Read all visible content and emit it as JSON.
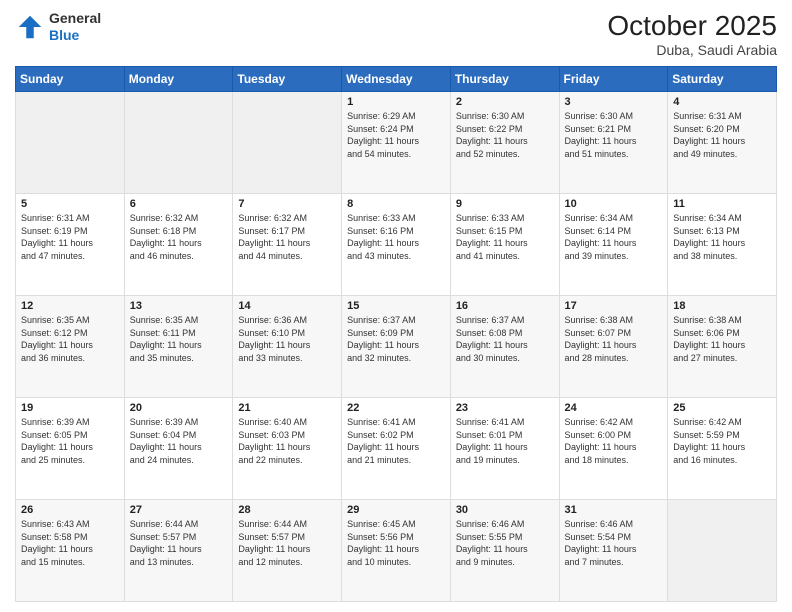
{
  "header": {
    "logo": {
      "general": "General",
      "blue": "Blue"
    },
    "title": "October 2025",
    "subtitle": "Duba, Saudi Arabia"
  },
  "days_of_week": [
    "Sunday",
    "Monday",
    "Tuesday",
    "Wednesday",
    "Thursday",
    "Friday",
    "Saturday"
  ],
  "weeks": [
    [
      {
        "day": "",
        "info": ""
      },
      {
        "day": "",
        "info": ""
      },
      {
        "day": "",
        "info": ""
      },
      {
        "day": "1",
        "info": "Sunrise: 6:29 AM\nSunset: 6:24 PM\nDaylight: 11 hours\nand 54 minutes."
      },
      {
        "day": "2",
        "info": "Sunrise: 6:30 AM\nSunset: 6:22 PM\nDaylight: 11 hours\nand 52 minutes."
      },
      {
        "day": "3",
        "info": "Sunrise: 6:30 AM\nSunset: 6:21 PM\nDaylight: 11 hours\nand 51 minutes."
      },
      {
        "day": "4",
        "info": "Sunrise: 6:31 AM\nSunset: 6:20 PM\nDaylight: 11 hours\nand 49 minutes."
      }
    ],
    [
      {
        "day": "5",
        "info": "Sunrise: 6:31 AM\nSunset: 6:19 PM\nDaylight: 11 hours\nand 47 minutes."
      },
      {
        "day": "6",
        "info": "Sunrise: 6:32 AM\nSunset: 6:18 PM\nDaylight: 11 hours\nand 46 minutes."
      },
      {
        "day": "7",
        "info": "Sunrise: 6:32 AM\nSunset: 6:17 PM\nDaylight: 11 hours\nand 44 minutes."
      },
      {
        "day": "8",
        "info": "Sunrise: 6:33 AM\nSunset: 6:16 PM\nDaylight: 11 hours\nand 43 minutes."
      },
      {
        "day": "9",
        "info": "Sunrise: 6:33 AM\nSunset: 6:15 PM\nDaylight: 11 hours\nand 41 minutes."
      },
      {
        "day": "10",
        "info": "Sunrise: 6:34 AM\nSunset: 6:14 PM\nDaylight: 11 hours\nand 39 minutes."
      },
      {
        "day": "11",
        "info": "Sunrise: 6:34 AM\nSunset: 6:13 PM\nDaylight: 11 hours\nand 38 minutes."
      }
    ],
    [
      {
        "day": "12",
        "info": "Sunrise: 6:35 AM\nSunset: 6:12 PM\nDaylight: 11 hours\nand 36 minutes."
      },
      {
        "day": "13",
        "info": "Sunrise: 6:35 AM\nSunset: 6:11 PM\nDaylight: 11 hours\nand 35 minutes."
      },
      {
        "day": "14",
        "info": "Sunrise: 6:36 AM\nSunset: 6:10 PM\nDaylight: 11 hours\nand 33 minutes."
      },
      {
        "day": "15",
        "info": "Sunrise: 6:37 AM\nSunset: 6:09 PM\nDaylight: 11 hours\nand 32 minutes."
      },
      {
        "day": "16",
        "info": "Sunrise: 6:37 AM\nSunset: 6:08 PM\nDaylight: 11 hours\nand 30 minutes."
      },
      {
        "day": "17",
        "info": "Sunrise: 6:38 AM\nSunset: 6:07 PM\nDaylight: 11 hours\nand 28 minutes."
      },
      {
        "day": "18",
        "info": "Sunrise: 6:38 AM\nSunset: 6:06 PM\nDaylight: 11 hours\nand 27 minutes."
      }
    ],
    [
      {
        "day": "19",
        "info": "Sunrise: 6:39 AM\nSunset: 6:05 PM\nDaylight: 11 hours\nand 25 minutes."
      },
      {
        "day": "20",
        "info": "Sunrise: 6:39 AM\nSunset: 6:04 PM\nDaylight: 11 hours\nand 24 minutes."
      },
      {
        "day": "21",
        "info": "Sunrise: 6:40 AM\nSunset: 6:03 PM\nDaylight: 11 hours\nand 22 minutes."
      },
      {
        "day": "22",
        "info": "Sunrise: 6:41 AM\nSunset: 6:02 PM\nDaylight: 11 hours\nand 21 minutes."
      },
      {
        "day": "23",
        "info": "Sunrise: 6:41 AM\nSunset: 6:01 PM\nDaylight: 11 hours\nand 19 minutes."
      },
      {
        "day": "24",
        "info": "Sunrise: 6:42 AM\nSunset: 6:00 PM\nDaylight: 11 hours\nand 18 minutes."
      },
      {
        "day": "25",
        "info": "Sunrise: 6:42 AM\nSunset: 5:59 PM\nDaylight: 11 hours\nand 16 minutes."
      }
    ],
    [
      {
        "day": "26",
        "info": "Sunrise: 6:43 AM\nSunset: 5:58 PM\nDaylight: 11 hours\nand 15 minutes."
      },
      {
        "day": "27",
        "info": "Sunrise: 6:44 AM\nSunset: 5:57 PM\nDaylight: 11 hours\nand 13 minutes."
      },
      {
        "day": "28",
        "info": "Sunrise: 6:44 AM\nSunset: 5:57 PM\nDaylight: 11 hours\nand 12 minutes."
      },
      {
        "day": "29",
        "info": "Sunrise: 6:45 AM\nSunset: 5:56 PM\nDaylight: 11 hours\nand 10 minutes."
      },
      {
        "day": "30",
        "info": "Sunrise: 6:46 AM\nSunset: 5:55 PM\nDaylight: 11 hours\nand 9 minutes."
      },
      {
        "day": "31",
        "info": "Sunrise: 6:46 AM\nSunset: 5:54 PM\nDaylight: 11 hours\nand 7 minutes."
      },
      {
        "day": "",
        "info": ""
      }
    ]
  ]
}
